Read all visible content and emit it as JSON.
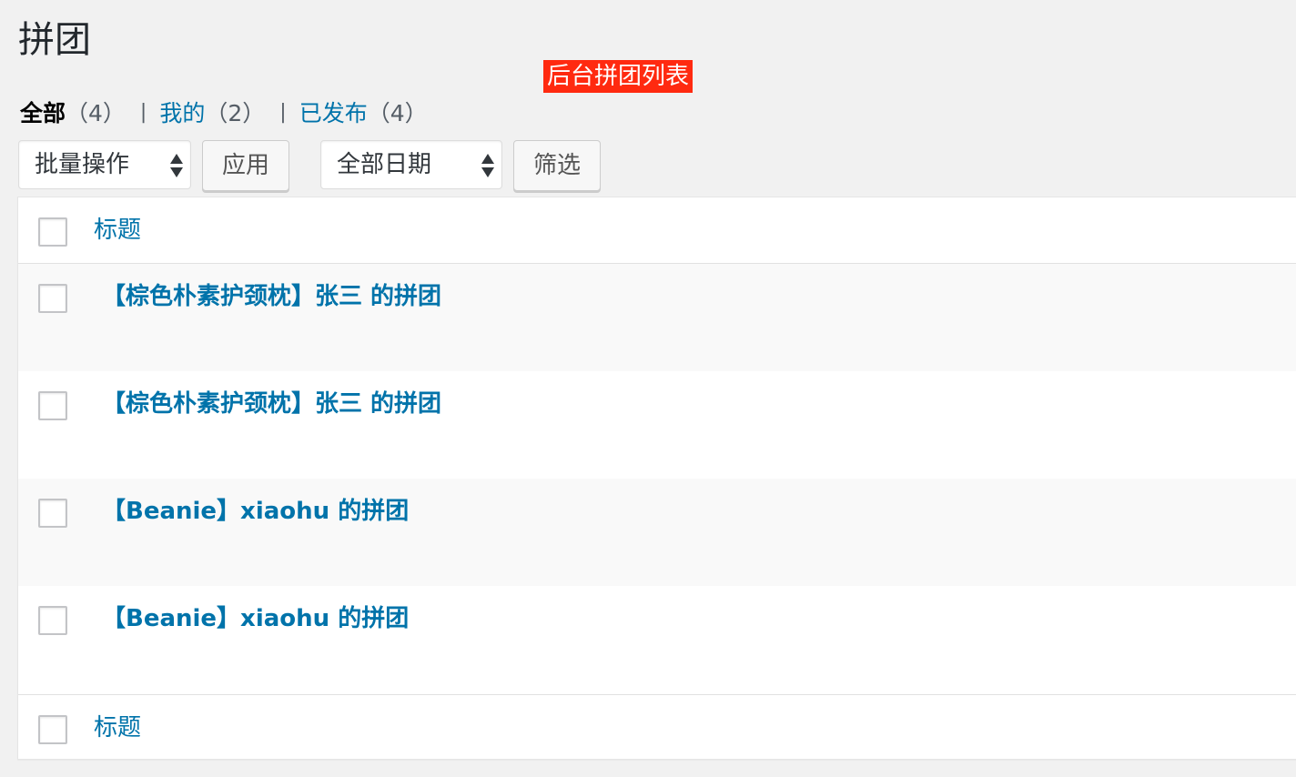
{
  "page": {
    "title": "拼团"
  },
  "annotation": {
    "text": "后台拼团列表"
  },
  "filters": [
    {
      "label": "全部",
      "count": "（4）",
      "current": true
    },
    {
      "label": "我的",
      "count": "（2）",
      "current": false
    },
    {
      "label": "已发布",
      "count": "（4）",
      "current": false
    }
  ],
  "separator": "|",
  "tablenav": {
    "bulk_action": "批量操作",
    "apply_label": "应用",
    "date_filter": "全部日期",
    "filter_label": "筛选"
  },
  "table": {
    "column_title": "标题",
    "rows": [
      {
        "title": "【棕色朴素护颈枕】张三 的拼团"
      },
      {
        "title": "【棕色朴素护颈枕】张三 的拼团"
      },
      {
        "title": "【Beanie】xiaohu 的拼团"
      },
      {
        "title": "【Beanie】xiaohu 的拼团"
      }
    ]
  }
}
